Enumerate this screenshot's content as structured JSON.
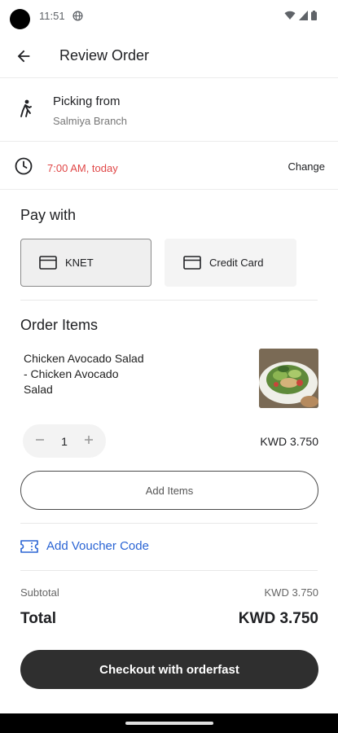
{
  "status_bar": {
    "time": "11:51"
  },
  "app_bar": {
    "title": "Review Order"
  },
  "pickup": {
    "label": "Picking from",
    "branch": "Salmiya Branch"
  },
  "schedule": {
    "time": "7:00 AM, today",
    "change_label": "Change",
    "time_color": "#e04646"
  },
  "payment": {
    "heading": "Pay with",
    "options": [
      {
        "label": "KNET",
        "selected": true
      },
      {
        "label": "Credit Card",
        "selected": false
      }
    ]
  },
  "order": {
    "heading": "Order Items",
    "items": [
      {
        "name": "Chicken Avocado Salad - Chicken Avocado Salad",
        "quantity": "1",
        "price": "KWD 3.750"
      }
    ],
    "add_items_label": "Add Items"
  },
  "voucher": {
    "label": "Add Voucher Code",
    "color": "#2a64d4"
  },
  "summary": {
    "subtotal_label": "Subtotal",
    "subtotal_value": "KWD 3.750",
    "total_label": "Total",
    "total_value": "KWD 3.750"
  },
  "checkout": {
    "label": "Checkout with orderfast"
  },
  "icons": [
    "back-arrow-icon",
    "walking-person-icon",
    "clock-icon",
    "card-icon",
    "voucher-ticket-icon",
    "minus-icon",
    "plus-icon",
    "globe-icon",
    "wifi-icon",
    "signal-icon",
    "battery-icon"
  ]
}
